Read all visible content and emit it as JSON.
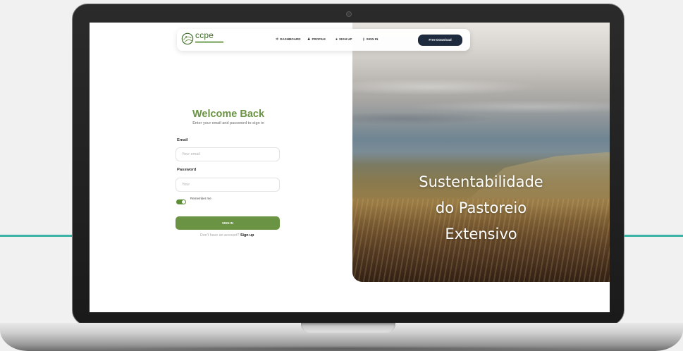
{
  "navbar": {
    "logo_text": "ccpe",
    "items": [
      {
        "label": "DASHBOARD",
        "icon": "rocket-icon"
      },
      {
        "label": "PROFILE",
        "icon": "user-icon"
      },
      {
        "label": "SIGN UP",
        "icon": "user-circle-icon"
      },
      {
        "label": "SIGN IN",
        "icon": "key-icon"
      }
    ],
    "cta_label": "Free Download"
  },
  "form": {
    "title": "Welcome Back",
    "subtitle": "Enter your email and password to sign in",
    "email_label": "Email",
    "email_placeholder": "Your email",
    "password_label": "Password",
    "password_placeholder": "Your",
    "remember_label": "Remember me",
    "remember_checked": true,
    "submit_label": "SIGN IN",
    "signup_prompt": "Don't have an account?",
    "signup_link": "Sign up"
  },
  "hero": {
    "title_lines": [
      "Sustentabilidade",
      "do Pastoreio",
      "Extensivo"
    ]
  },
  "colors": {
    "brand_green": "#6a9343",
    "cta_navy": "#1e2a3e",
    "accent_teal": "#3bb3a4"
  }
}
